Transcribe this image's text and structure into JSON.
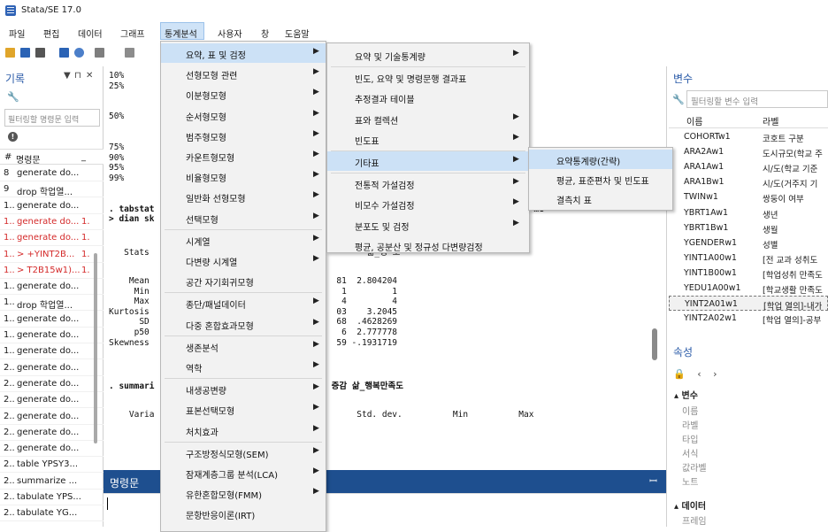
{
  "window": {
    "title": "Stata/SE 17.0"
  },
  "menubar": [
    "파일",
    "편집",
    "데이터",
    "그래프",
    "통계분석",
    "사용자",
    "창",
    "도움말"
  ],
  "history": {
    "title": "기록",
    "filter_placeholder": "필터링할 명령문 입력",
    "col_num": "#",
    "col_cmd": "명령문",
    "col_rc": "_",
    "rows": [
      {
        "n": "8",
        "cmd": "generate do...",
        "rc": "",
        "err": false
      },
      {
        "n": "9",
        "cmd": "drop 학업열...",
        "rc": "",
        "err": false
      },
      {
        "n": "1..",
        "cmd": "generate do...",
        "rc": "",
        "err": false
      },
      {
        "n": "1..",
        "cmd": "generate do...",
        "rc": "1.",
        "err": true
      },
      {
        "n": "1..",
        "cmd": "generate do...",
        "rc": "1.",
        "err": true
      },
      {
        "n": "1..",
        "cmd": "> +YINT2B...",
        "rc": "1.",
        "err": true
      },
      {
        "n": "1..",
        "cmd": "> T2B15w1)...",
        "rc": "1.",
        "err": true
      },
      {
        "n": "1..",
        "cmd": "generate do...",
        "rc": "",
        "err": false
      },
      {
        "n": "1..",
        "cmd": "drop 학업열...",
        "rc": "",
        "err": false
      },
      {
        "n": "1..",
        "cmd": "generate do...",
        "rc": "",
        "err": false
      },
      {
        "n": "1..",
        "cmd": "generate do...",
        "rc": "",
        "err": false
      },
      {
        "n": "1..",
        "cmd": "generate do...",
        "rc": "",
        "err": false
      },
      {
        "n": "2..",
        "cmd": "generate do...",
        "rc": "",
        "err": false
      },
      {
        "n": "2..",
        "cmd": "generate do...",
        "rc": "",
        "err": false
      },
      {
        "n": "2..",
        "cmd": "generate do...",
        "rc": "",
        "err": false
      },
      {
        "n": "2..",
        "cmd": "generate do...",
        "rc": "",
        "err": false
      },
      {
        "n": "2..",
        "cmd": "generate do...",
        "rc": "",
        "err": false
      },
      {
        "n": "2..",
        "cmd": "generate do...",
        "rc": "",
        "err": false
      },
      {
        "n": "2..",
        "cmd": "table YPSY3...",
        "rc": "",
        "err": false
      },
      {
        "n": "2..",
        "cmd": "summarize ...",
        "rc": "",
        "err": false
      },
      {
        "n": "2..",
        "cmd": "tabulate YPS...",
        "rc": "",
        "err": false
      },
      {
        "n": "2..",
        "cmd": "tabulate YG...",
        "rc": "",
        "err": false
      }
    ]
  },
  "results": {
    "lines": [
      {
        "t": "10%",
        "b": false
      },
      {
        "t": "25%",
        "b": false
      },
      {
        "t": "",
        "b": false
      },
      {
        "t": "",
        "b": false
      },
      {
        "t": "50%",
        "b": false
      },
      {
        "t": "",
        "b": false
      },
      {
        "t": "",
        "b": false
      },
      {
        "t": "75%",
        "b": false
      },
      {
        "t": "90%",
        "b": false
      },
      {
        "t": "95%",
        "b": false
      },
      {
        "t": "99%",
        "b": false
      },
      {
        "t": "",
        "b": false
      },
      {
        "t": "",
        "b": false
      },
      {
        "t": ". tabstat                                                        in max kurtosis sd me",
        "b": true
      },
      {
        "t": "> dian sk",
        "b": true
      },
      {
        "t": "",
        "b": false
      },
      {
        "t": "",
        "b": false
      },
      {
        "t": "   Stats                                           삶_행~도",
        "b": false
      },
      {
        "t": "",
        "b": false
      },
      {
        "t": "",
        "b": false
      },
      {
        "t": "    Mean                                     81  2.804204",
        "b": false
      },
      {
        "t": "     Min                                      1         1",
        "b": false
      },
      {
        "t": "     Max                                      4         4",
        "b": false
      },
      {
        "t": "Kurtosis                                     03    3.2045",
        "b": false
      },
      {
        "t": "      SD                                     68  .4628269",
        "b": false
      },
      {
        "t": "     p50                                      6  2.777778",
        "b": false
      },
      {
        "t": "Skewness                                     59 -.1931719",
        "b": false
      },
      {
        "t": "",
        "b": false
      },
      {
        "t": "",
        "b": false
      },
      {
        "t": "",
        "b": false
      },
      {
        "t": ". summari                                   증감 삶_행복만족도",
        "b": true
      },
      {
        "t": "",
        "b": false
      },
      {
        "t": "",
        "b": false
      },
      {
        "t": "    Varia                                        Std. dev.          Min          Max",
        "b": false
      }
    ]
  },
  "command": {
    "title": "명령문",
    "pin": "ꟷ"
  },
  "variables": {
    "title": "변수",
    "filter_placeholder": "필터링할 변수 입력",
    "col_name": "이름",
    "col_label": "라벨",
    "rows": [
      {
        "name": "COHORTw1",
        "label": "코호트 구분",
        "sel": false
      },
      {
        "name": "ARA2Aw1",
        "label": "도시규모(학교 주",
        "sel": false
      },
      {
        "name": "ARA1Aw1",
        "label": "시/도(학교 기준",
        "sel": false
      },
      {
        "name": "ARA1Bw1",
        "label": "시/도(거주지 기",
        "sel": false
      },
      {
        "name": "TWINw1",
        "label": "쌍둥이 여부",
        "sel": false
      },
      {
        "name": "YBRT1Aw1",
        "label": "생년",
        "sel": false
      },
      {
        "name": "YBRT1Bw1",
        "label": "생월",
        "sel": false
      },
      {
        "name": "YGENDERw1",
        "label": "성별",
        "sel": false
      },
      {
        "name": "YINT1A00w1",
        "label": "[전 교과 성취도",
        "sel": false
      },
      {
        "name": "YINT1B00w1",
        "label": "[학업성취 만족도",
        "sel": false
      },
      {
        "name": "YEDU1A00w1",
        "label": "[학교생활 만족도",
        "sel": false
      },
      {
        "name": "YINT2A01w1",
        "label": "[학업 열의]-내가",
        "sel": true
      },
      {
        "name": "YINT2A02w1",
        "label": "[학업 열의]-공부",
        "sel": false
      }
    ]
  },
  "properties": {
    "title": "속성",
    "section_vars": "변수",
    "var_rows": [
      "이름",
      "라벨",
      "타입",
      "서식",
      "값라벨",
      "노트"
    ],
    "section_data": "데이터",
    "data_rows": [
      "프레임"
    ]
  },
  "menu1": {
    "items": [
      {
        "label": "요약, 표 및 검정",
        "sub": true,
        "hl": true
      },
      {
        "label": "선형모형 관련",
        "sub": true
      },
      {
        "label": "이분형모형",
        "sub": true
      },
      {
        "label": "순서형모형",
        "sub": true
      },
      {
        "label": "범주형모형",
        "sub": true
      },
      {
        "label": "카운트형모형",
        "sub": true
      },
      {
        "label": "비율형모형",
        "sub": true
      },
      {
        "label": "일반화 선형모형",
        "sub": true
      },
      {
        "label": "선택모형",
        "sub": true
      },
      {
        "label": "시계열",
        "sub": true
      },
      {
        "label": "다변량 시계열",
        "sub": true
      },
      {
        "label": "공간 자기회귀모형",
        "sub": false
      },
      {
        "label": "종단/패널데이터",
        "sub": true
      },
      {
        "label": "다중 혼합효과모형",
        "sub": true
      },
      {
        "label": "생존분석",
        "sub": true
      },
      {
        "label": "역학",
        "sub": true
      },
      {
        "label": "내생공변량",
        "sub": true
      },
      {
        "label": "표본선택모형",
        "sub": true
      },
      {
        "label": "처치효과",
        "sub": true
      },
      {
        "label": "구조방정식모형(SEM)",
        "sub": true
      },
      {
        "label": "잠재계층그룹 분석(LCA)",
        "sub": true
      },
      {
        "label": "유한혼합모형(FMM)",
        "sub": true
      },
      {
        "label": "문항반응이론(IRT)",
        "sub": false
      }
    ]
  },
  "menu2": {
    "items": [
      {
        "label": "요약 및 기술통계량",
        "sub": true
      },
      {
        "label": "빈도, 요약 및 명령문행 결과표",
        "sub": false
      },
      {
        "label": "추정결과 테이블",
        "sub": false
      },
      {
        "label": "표와 컬렉션",
        "sub": true
      },
      {
        "label": "빈도표",
        "sub": true
      },
      {
        "label": "기타표",
        "sub": true,
        "hl": true
      },
      {
        "label": "전통적 가설검정",
        "sub": true
      },
      {
        "label": "비모수 가설검정",
        "sub": true
      },
      {
        "label": "분포도 및 검정",
        "sub": true
      },
      {
        "label": "평균, 공분산 및 정규성 다변량검정",
        "sub": false
      }
    ]
  },
  "menu3": {
    "items": [
      {
        "label": "요약통계량(간략)",
        "hl": true
      },
      {
        "label": "평균, 표준편차 및 빈도표"
      },
      {
        "label": "결측치 표"
      }
    ]
  }
}
